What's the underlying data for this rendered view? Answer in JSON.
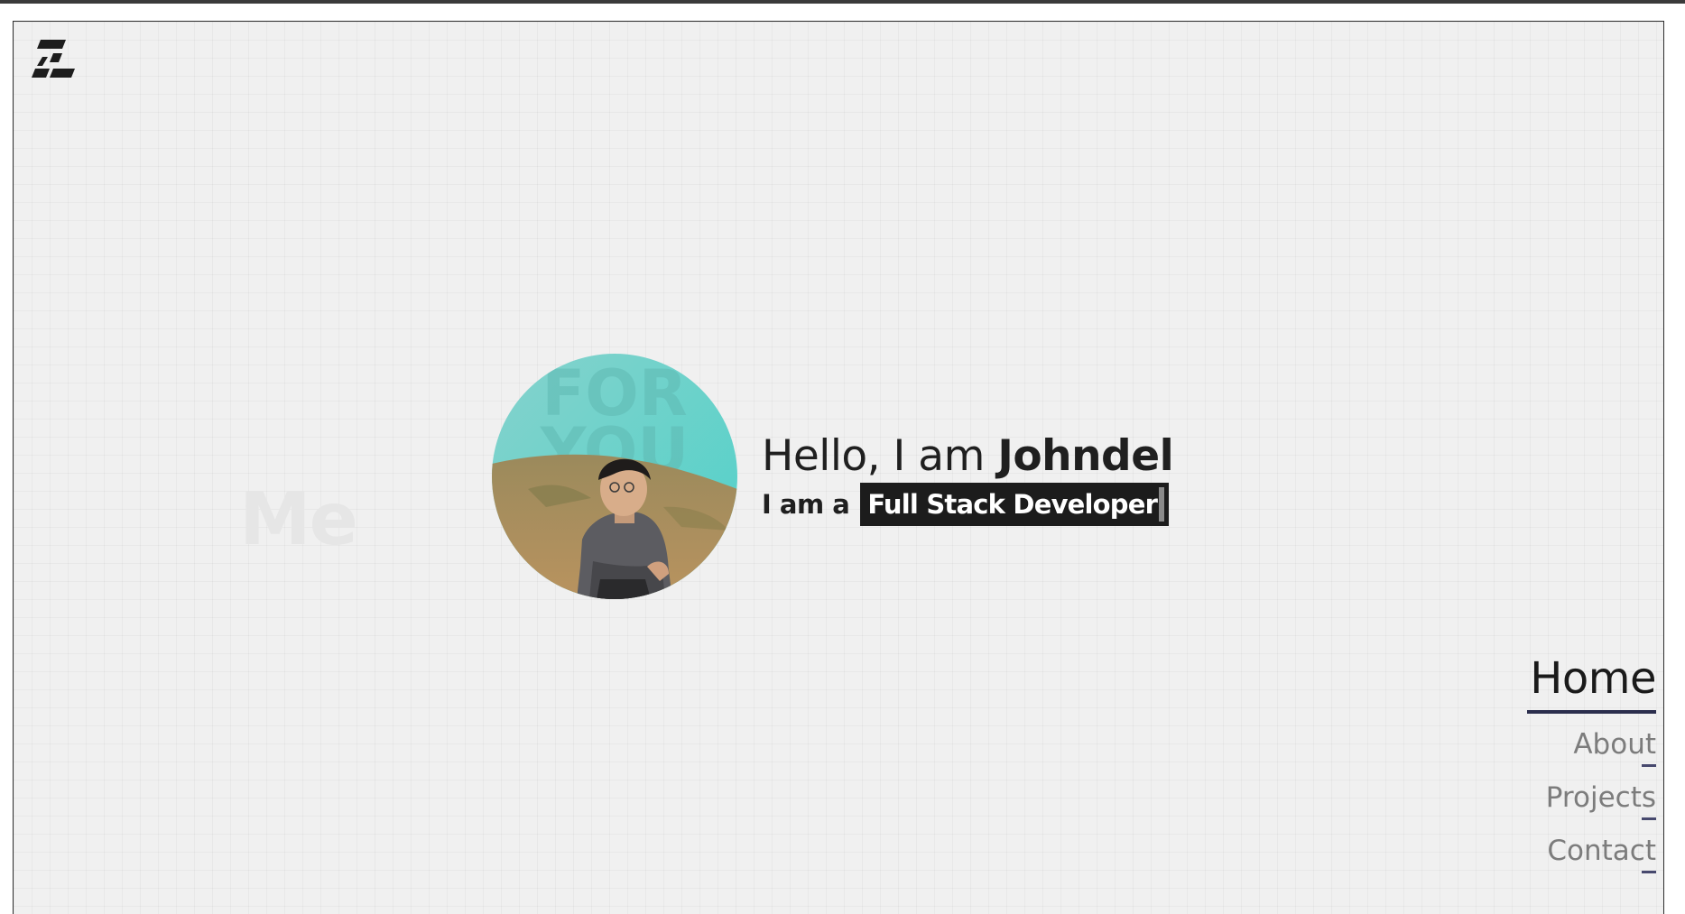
{
  "intro": {
    "greeting": "Hello, I am",
    "name": "Johndel",
    "role_prefix": "I am a",
    "role": "Full Stack Developer"
  },
  "background_word": "Me",
  "avatar_overlay_text": [
    "FOR",
    "YOU"
  ],
  "nav": {
    "items": [
      {
        "label": "Home",
        "active": true
      },
      {
        "label": "About",
        "active": false
      },
      {
        "label": "Projects",
        "active": false
      },
      {
        "label": "Contact",
        "active": false
      }
    ]
  },
  "colors": {
    "background": "#f0f0f0",
    "text": "#1f1f1f",
    "accent": "#2b2e4d",
    "muted_nav": "#7c7c7c",
    "role_highlight": "#1c1c1c"
  },
  "icons": {
    "logo": "stacked-stripes-logo-icon"
  }
}
